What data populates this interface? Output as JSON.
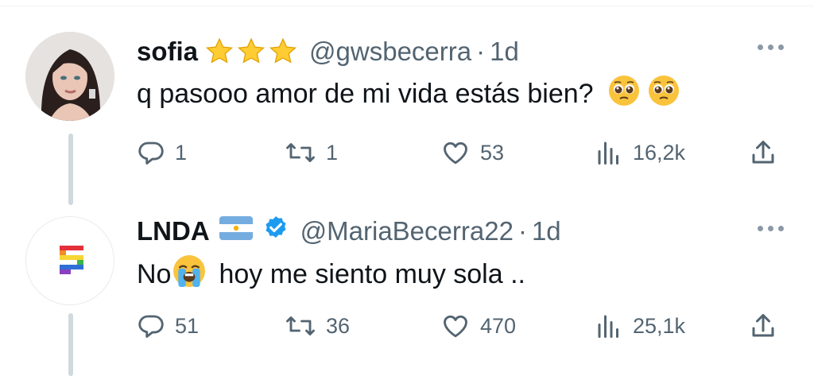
{
  "tweets": [
    {
      "name": "sofia",
      "handle": "@gwsbecerra",
      "separator": "·",
      "time": "1d",
      "text": "q pasooo amor de mi vida estás bien?",
      "emoji": [
        "pleading-face",
        "pleading-face"
      ],
      "name_decoration": [
        "star",
        "star",
        "star"
      ],
      "stats": {
        "replies": "1",
        "retweets": "1",
        "likes": "53",
        "views": "16,2k"
      }
    },
    {
      "name": "LNDA",
      "handle": "@MariaBecerra22",
      "separator": "·",
      "time": "1d",
      "text_before": "No",
      "text_after": "hoy me siento muy sola ..",
      "emoji": [
        "loudly-crying-face"
      ],
      "name_decoration": [
        "argentina-flag",
        "verified-badge"
      ],
      "stats": {
        "replies": "51",
        "retweets": "36",
        "likes": "470",
        "views": "25,1k"
      }
    }
  ],
  "colors": {
    "text": "#0f1419",
    "secondary": "#536471",
    "verified": "#1d9bf0",
    "star": "#ffcc33",
    "thread_line": "#cfd9de"
  }
}
